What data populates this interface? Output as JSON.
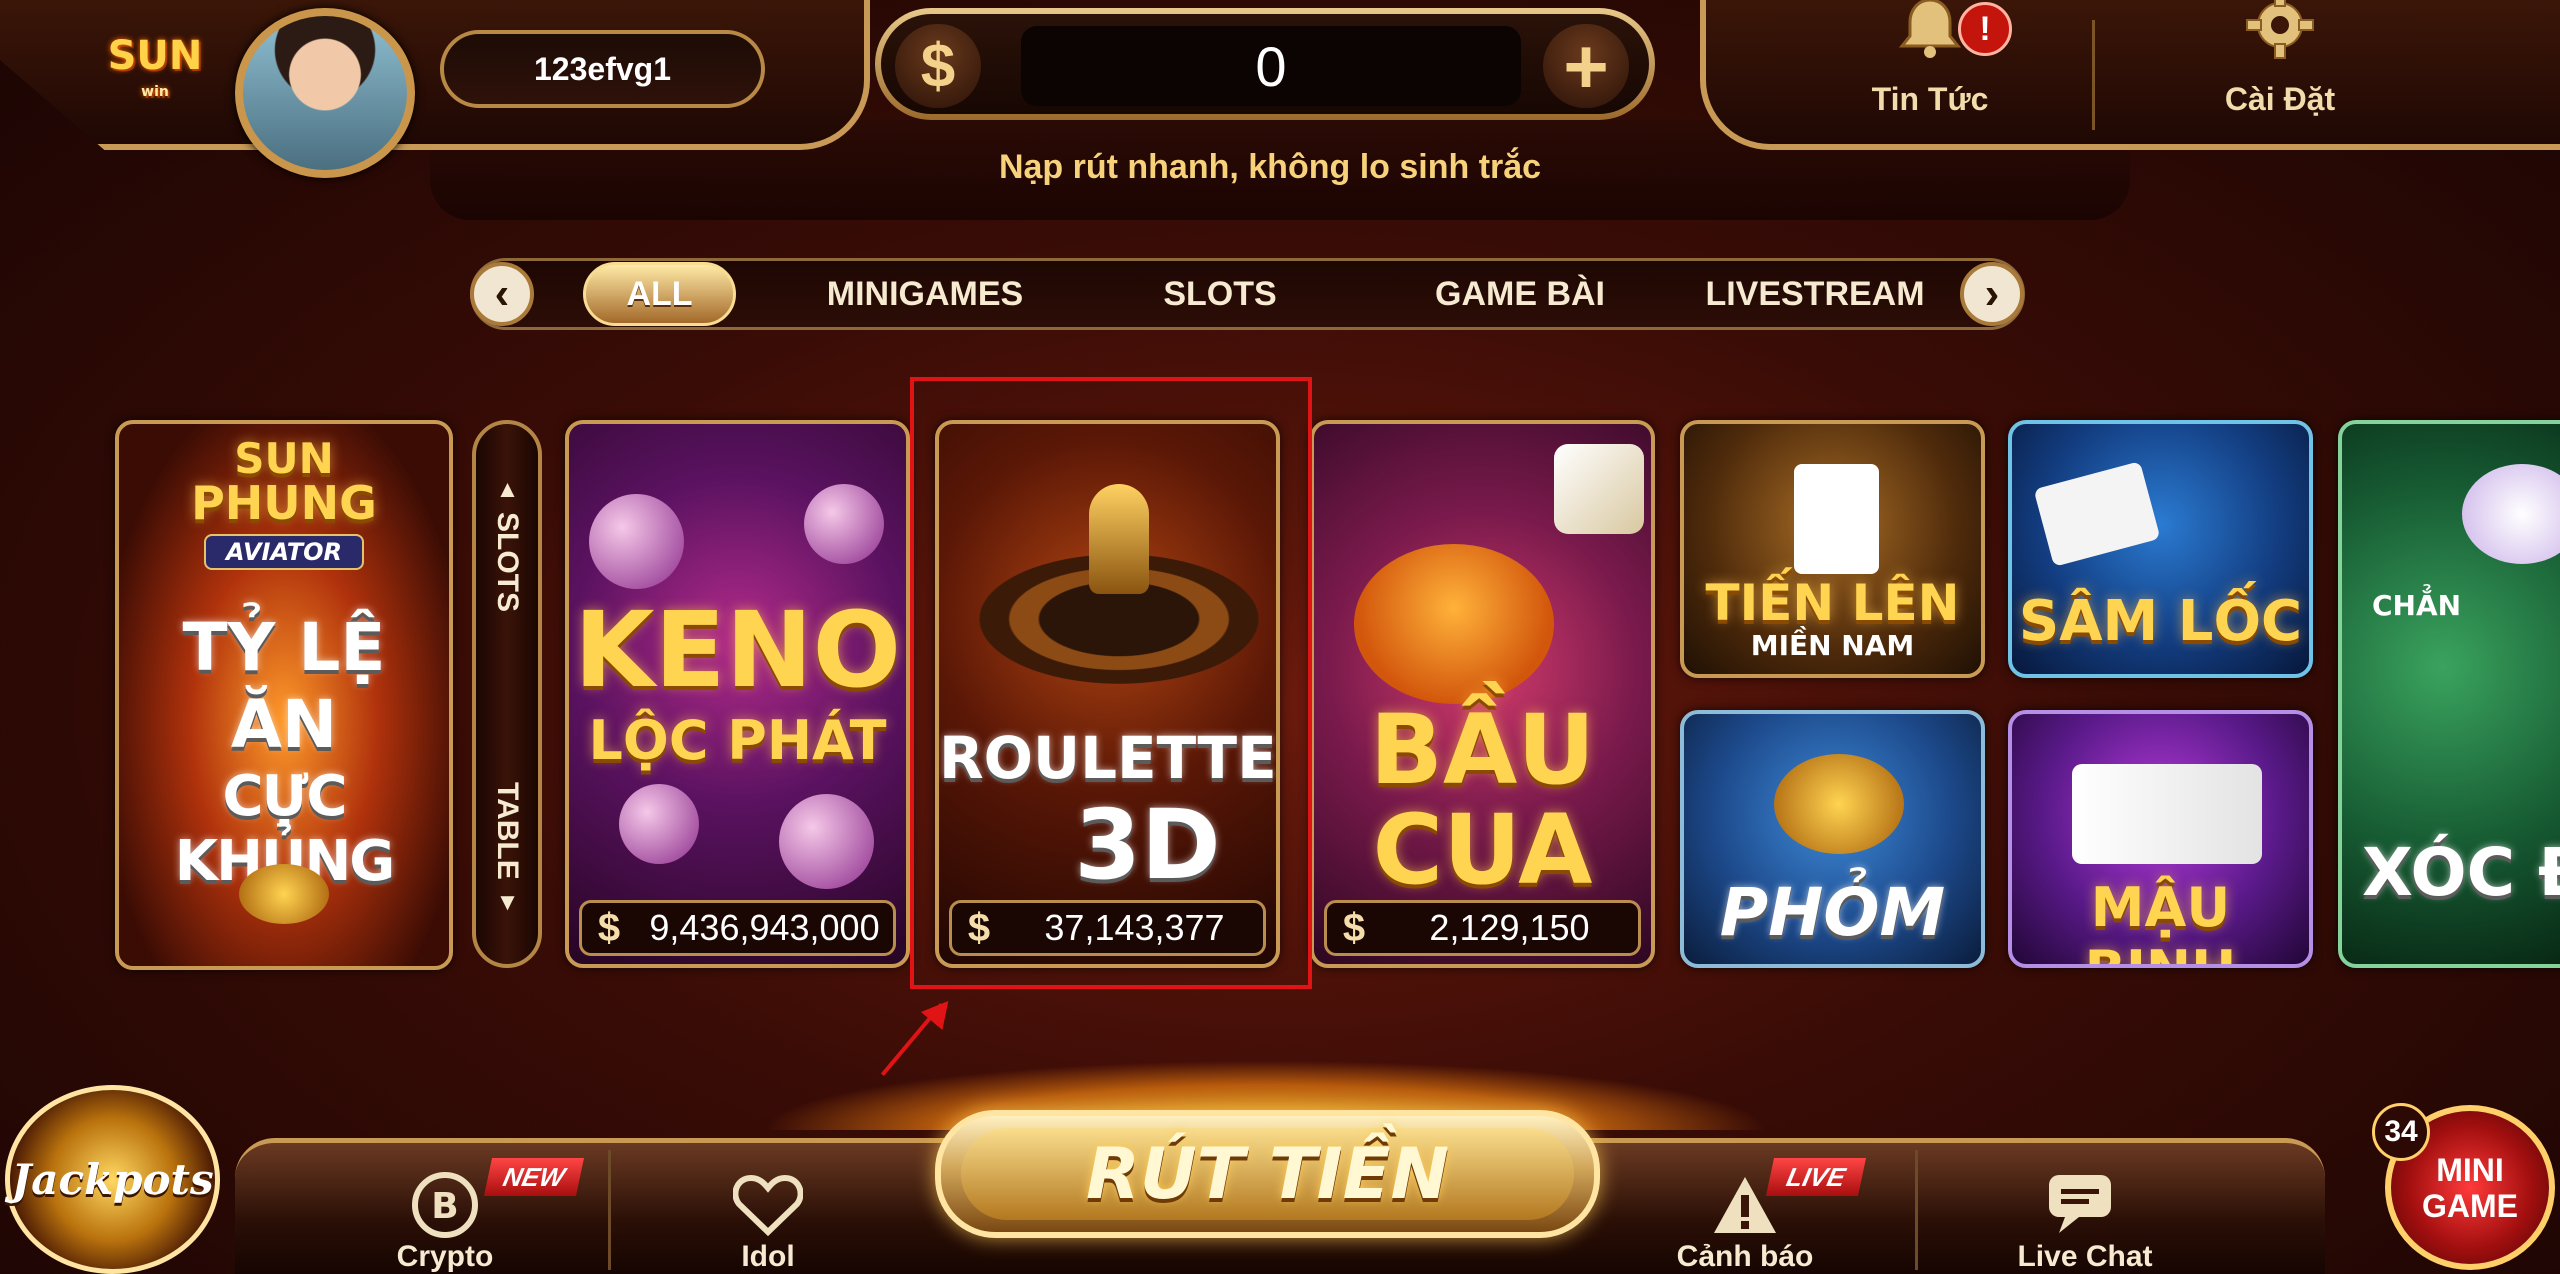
{
  "header": {
    "logo_text": "SUN",
    "logo_sub": "win",
    "username": "123efvg1",
    "balance_currency": "$",
    "balance": "0",
    "add_symbol": "+",
    "tagline": "Nạp rút nhanh, không lo sinh trắc",
    "news_label": "Tin Tức",
    "news_alert": "!",
    "settings_label": "Cài Đặt",
    "news_icon": "bell-icon",
    "settings_icon": "gear-icon"
  },
  "tabs": {
    "prev": "‹",
    "next": "›",
    "items": [
      {
        "label": "ALL",
        "active": true
      },
      {
        "label": "MINIGAMES",
        "active": false
      },
      {
        "label": "SLOTS",
        "active": false
      },
      {
        "label": "GAME BÀI",
        "active": false
      },
      {
        "label": "LIVESTREAM",
        "active": false
      }
    ]
  },
  "switch": {
    "slots": "SLOTS",
    "table": "TABLE"
  },
  "games": {
    "aviator": {
      "line1": "SUN",
      "line2": "PHUNG",
      "badge": "AVIATOR",
      "title1": "TỶ LỆ",
      "title2": "ĂN",
      "title3": "CỰC KHỦNG"
    },
    "keno": {
      "title1": "KENO",
      "title2": "LỘC PHÁT",
      "currency": "$",
      "jackpot": "9,436,943,000"
    },
    "roulette": {
      "title1": "ROULETTE",
      "title2": "3D",
      "currency": "$",
      "jackpot": "37,143,377"
    },
    "baucua": {
      "title1": "BẦU",
      "title2": "CUA",
      "currency": "$",
      "jackpot": "2,129,150"
    },
    "tienlen": {
      "title1": "TIẾN LÊN",
      "title2": "MIỀN NAM"
    },
    "phom": {
      "title": "PHỎM"
    },
    "samloc": {
      "title": "SÂM LỐC"
    },
    "maubinh": {
      "title": "MẬU BINH"
    },
    "xocdia": {
      "top": "CHẲN",
      "title": "XÓC Đ"
    }
  },
  "bottom": {
    "jackpots": "Jackpots",
    "crypto_label": "Crypto",
    "crypto_badge": "NEW",
    "idol_label": "Idol",
    "withdraw": "RÚT TIỀN",
    "alert_label": "Cảnh báo",
    "alert_badge": "LIVE",
    "chat_label": "Live Chat",
    "minigame_line1": "MINI",
    "minigame_line2": "GAME",
    "minigame_count": "34"
  }
}
